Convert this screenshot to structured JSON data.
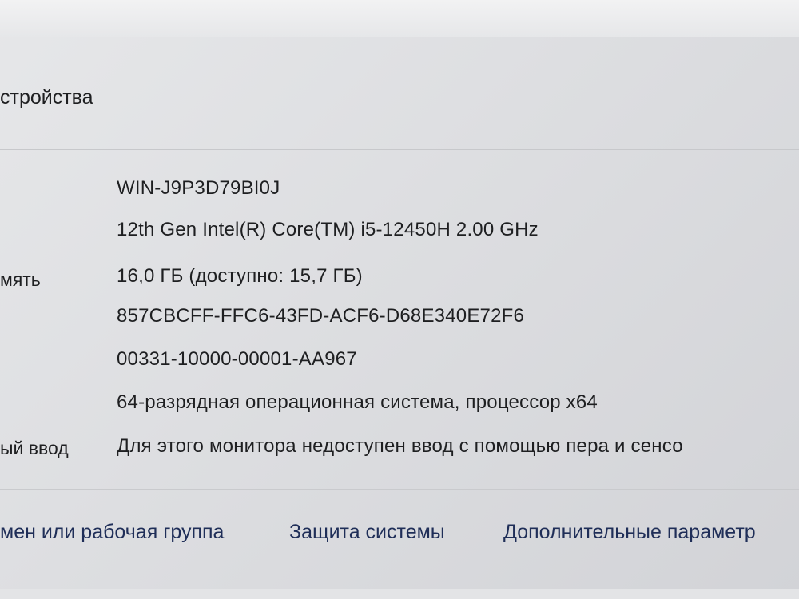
{
  "section": {
    "title_fragment": "стройства"
  },
  "specs": {
    "rows": [
      {
        "label": "",
        "value": "WIN-J9P3D79BI0J"
      },
      {
        "label": "",
        "value": "12th Gen Intel(R) Core(TM) i5-12450H   2.00 GHz"
      },
      {
        "label": "мять",
        "value": "16,0 ГБ (доступно: 15,7 ГБ)"
      },
      {
        "label": "",
        "value": "857CBCFF-FFC6-43FD-ACF6-D68E340E72F6"
      },
      {
        "label": "",
        "value": "00331-10000-00001-AA967"
      },
      {
        "label": "",
        "value": "64-разрядная операционная система, процессор x64"
      },
      {
        "label": "ый ввод",
        "value": "Для этого монитора недоступен ввод с помощью пера и сенсо"
      }
    ]
  },
  "links": {
    "domain_workgroup": "мен или рабочая группа",
    "system_protection": "Защита системы",
    "advanced_settings": "Дополнительные параметр"
  }
}
